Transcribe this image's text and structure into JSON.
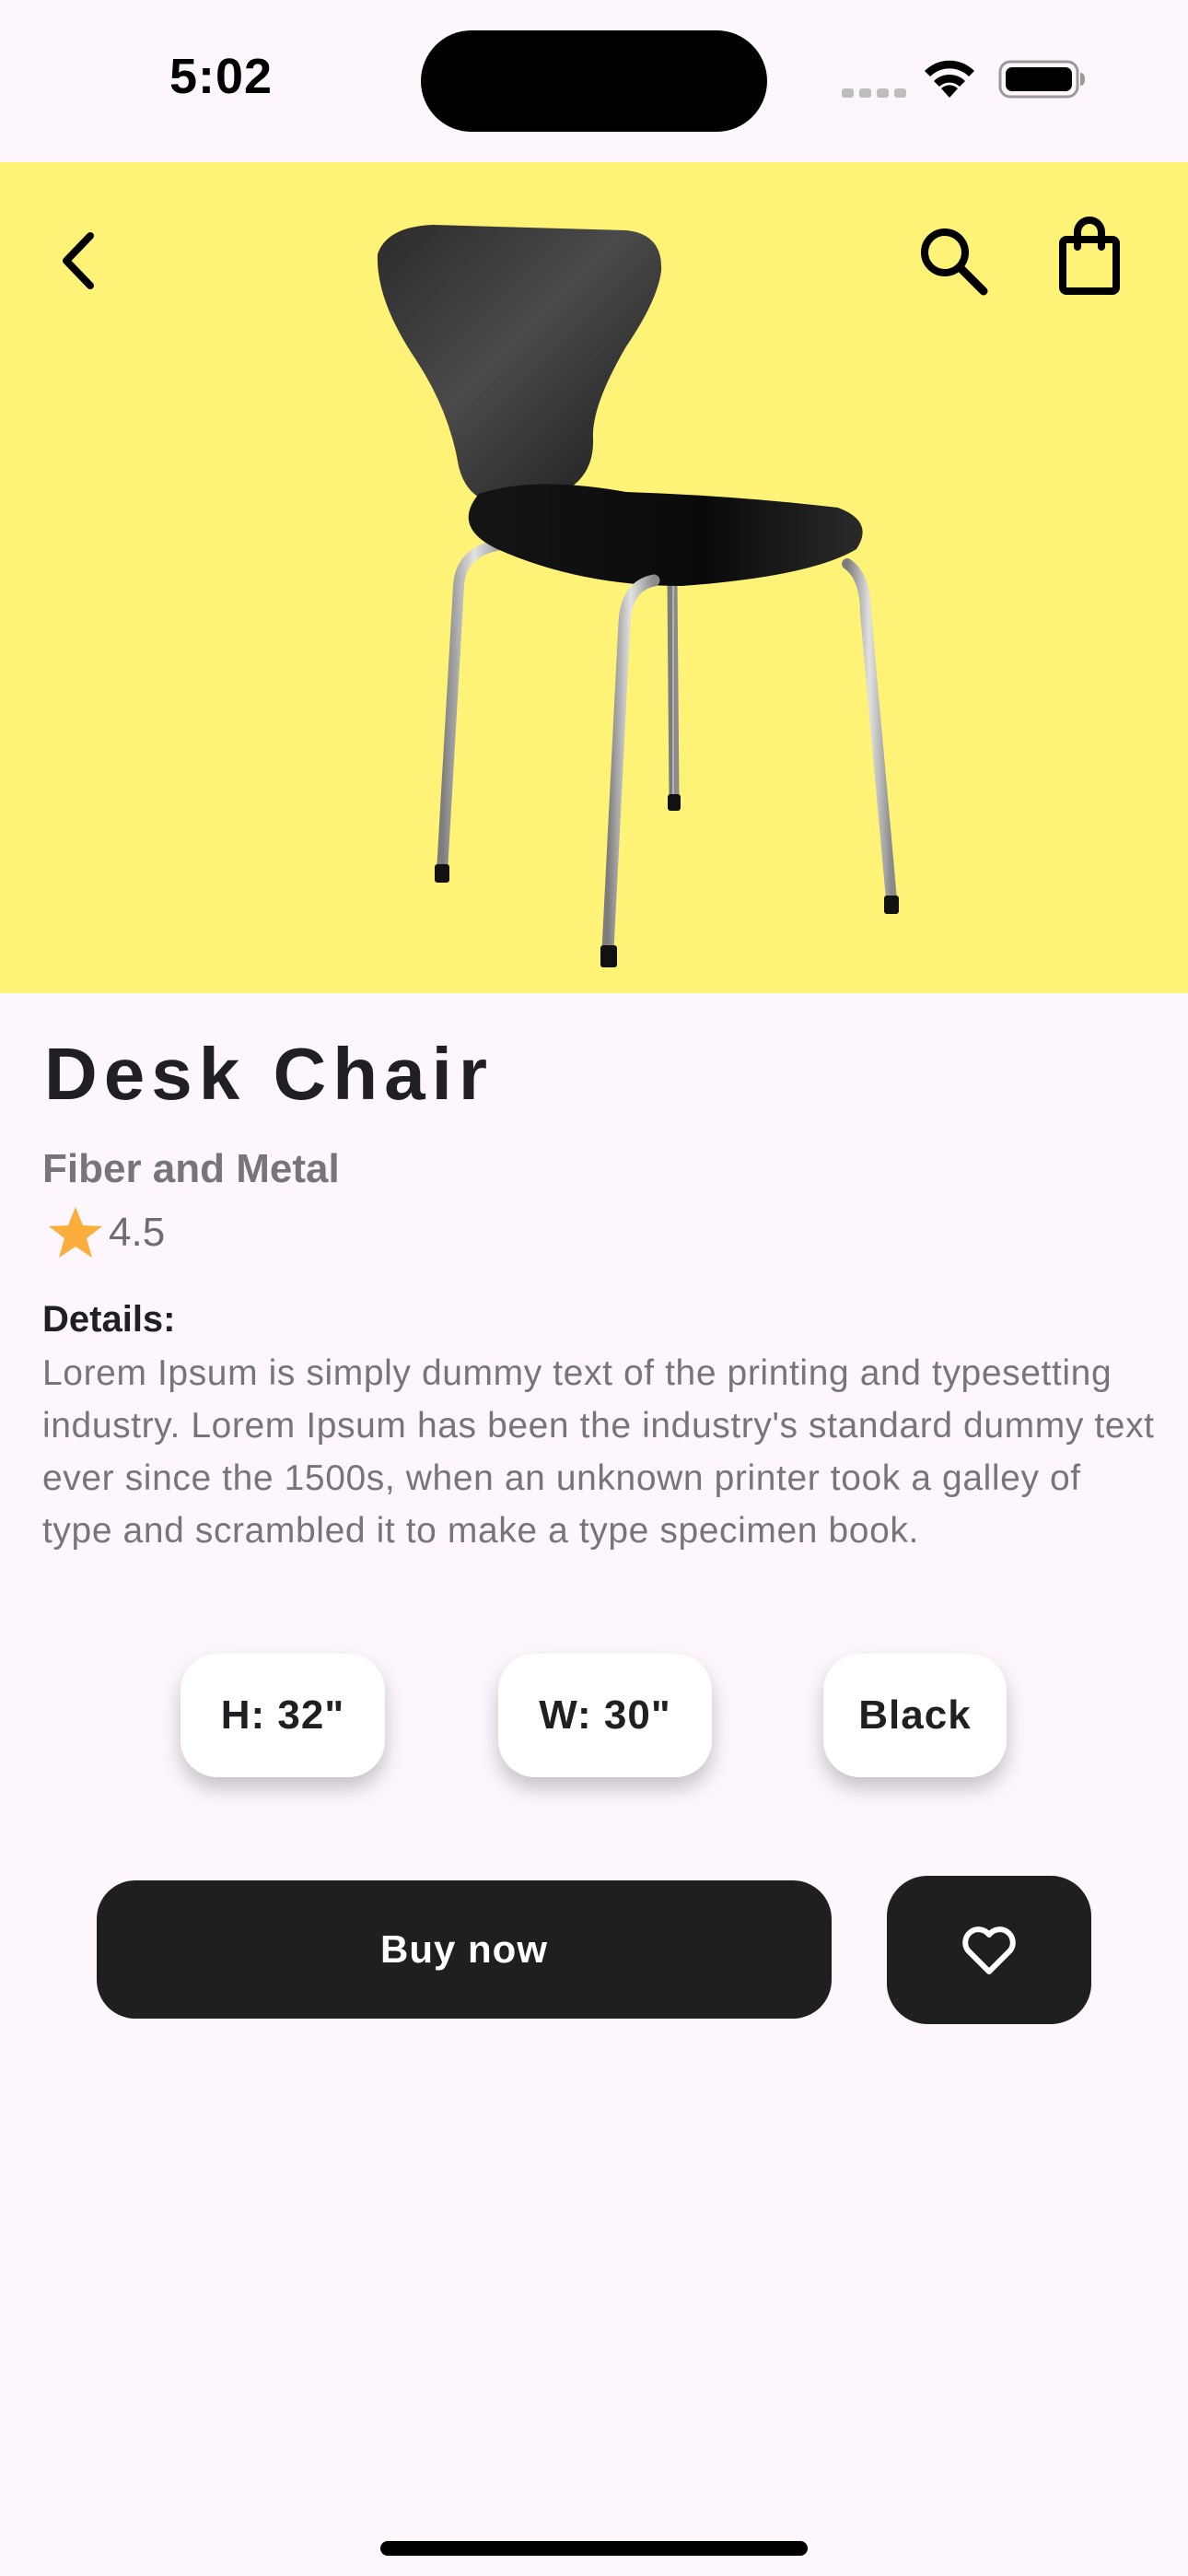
{
  "status_bar": {
    "time": "5:02"
  },
  "hero": {
    "background_color": "#FEF277",
    "icons": [
      "back-arrow-icon",
      "search-icon",
      "shopping-bag-icon"
    ],
    "image": "black-chair-image"
  },
  "product": {
    "title": "Desk Chair",
    "subtitle": "Fiber and Metal",
    "rating": "4.5",
    "star_color": "#FBAE3C",
    "details_heading": "Details:",
    "details_body": "Lorem Ipsum is simply dummy text of the printing and typesetting industry. Lorem Ipsum has been the industry's standard dummy text ever since the 1500s, when an unknown printer took a galley of type and scrambled it to make a type specimen book."
  },
  "specs": {
    "height": "H: 32\"",
    "width": "W: 30\"",
    "color": "Black"
  },
  "actions": {
    "buy_label": "Buy now",
    "favorite_icon": "heart-outline-icon",
    "button_color": "#1F1F1F"
  }
}
